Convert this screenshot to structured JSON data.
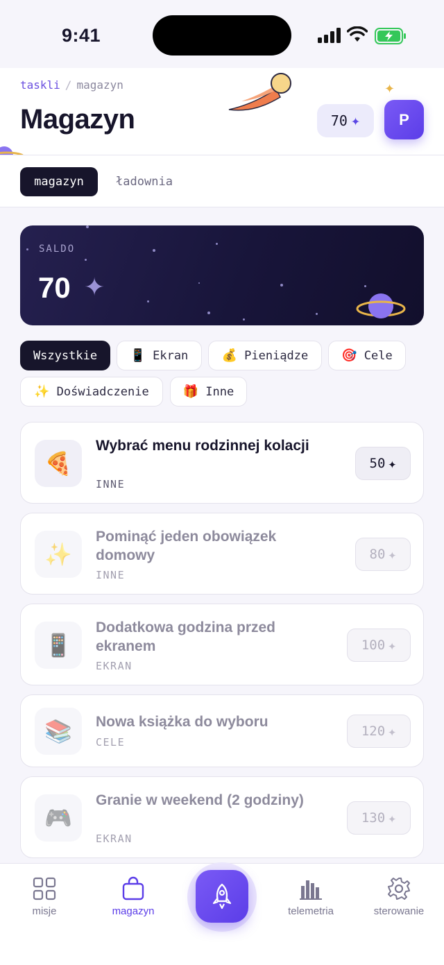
{
  "status_bar": {
    "time": "9:41"
  },
  "breadcrumb": {
    "root": "taskli",
    "separator": "/",
    "current": "magazyn"
  },
  "page_title": "Magazyn",
  "points": {
    "value": "70",
    "icon": "sparkle-icon"
  },
  "avatar": {
    "initial": "P"
  },
  "tabs": [
    {
      "label": "magazyn",
      "active": true
    },
    {
      "label": "ładownia",
      "active": false
    }
  ],
  "balance": {
    "label": "SALDO",
    "amount": "70"
  },
  "filters": [
    {
      "label": "Wszystkie",
      "emoji": "",
      "active": true
    },
    {
      "label": "Ekran",
      "emoji": "📱",
      "active": false
    },
    {
      "label": "Pieniądze",
      "emoji": "💰",
      "active": false
    },
    {
      "label": "Cele",
      "emoji": "🎯",
      "active": false
    },
    {
      "label": "Doświadczenie",
      "emoji": "✨",
      "active": false
    },
    {
      "label": "Inne",
      "emoji": "🎁",
      "active": false
    }
  ],
  "rewards": [
    {
      "name": "Wybrać menu rodzinnej kolacji",
      "category": "INNE",
      "price": "50",
      "emoji": "🍕",
      "available": true
    },
    {
      "name": "Pominąć jeden obowiązek domowy",
      "category": "INNE",
      "price": "80",
      "emoji": "✨",
      "available": false
    },
    {
      "name": "Dodatkowa godzina przed ekranem",
      "category": "EKRAN",
      "price": "100",
      "emoji": "📱",
      "available": false
    },
    {
      "name": "Nowa książka do wyboru",
      "category": "CELE",
      "price": "120",
      "emoji": "📚",
      "available": false
    },
    {
      "name": "Granie w weekend (2 godziny)",
      "category": "EKRAN",
      "price": "130",
      "emoji": "🎮",
      "available": false
    }
  ],
  "bottom_nav": [
    {
      "label": "misje",
      "icon": "grid-icon",
      "active": false
    },
    {
      "label": "magazyn",
      "icon": "bag-icon",
      "active": true
    },
    {
      "label": "",
      "icon": "rocket-icon",
      "active": false
    },
    {
      "label": "telemetria",
      "icon": "bar-chart-icon",
      "active": false
    },
    {
      "label": "sterowanie",
      "icon": "gear-icon",
      "active": false
    }
  ],
  "colors": {
    "accent": "#5b3de8",
    "dark": "#17152b",
    "background": "#f6f5fb"
  }
}
